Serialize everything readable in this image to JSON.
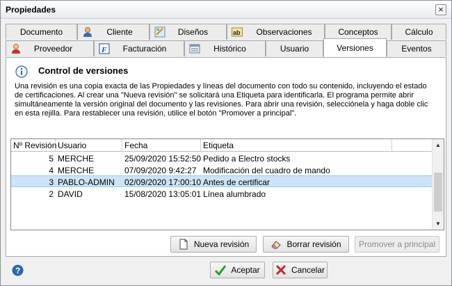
{
  "window": {
    "title": "Propiedades"
  },
  "tabs_row1": [
    {
      "label": "Documento",
      "icon": ""
    },
    {
      "label": "Cliente",
      "icon": "person-icon"
    },
    {
      "label": "Diseños",
      "icon": "design-icon"
    },
    {
      "label": "Observaciones",
      "icon": "text-ab-icon"
    },
    {
      "label": "Conceptos",
      "icon": ""
    },
    {
      "label": "Cálculo",
      "icon": ""
    }
  ],
  "tabs_row2": [
    {
      "label": "Proveedor",
      "icon": "supplier-icon"
    },
    {
      "label": "Facturación",
      "icon": "invoice-f-icon"
    },
    {
      "label": "Histórico",
      "icon": "history-icon"
    },
    {
      "label": "Usuario",
      "icon": ""
    },
    {
      "label": "Versiones",
      "icon": "",
      "active": true
    },
    {
      "label": "Eventos",
      "icon": ""
    }
  ],
  "panel": {
    "heading": "Control de versiones",
    "description": "Una revisión es una copia exacta de las Propiedades y  líneas del documento con todo su contenido, incluyendo el estado de certificaciones. Al crear una \"Nueva revisión\" se solicitará una Etiqueta para identificarla. El programa permite abrir simultáneamente la versión original del documento y las revisiones. Para abrir una revisión, selecciónela y haga doble clic en esta rejilla. Para restablecer una revisión, utilice el botón \"Promover a principal\"."
  },
  "grid": {
    "columns": [
      "Nº Revisión",
      "Usuario",
      "Fecha",
      "Etiqueta"
    ],
    "rows": [
      {
        "revision": "5",
        "user": "MERCHE",
        "date": "25/09/2020 15:52:50",
        "label": "Pedido a Electro stocks",
        "selected": false
      },
      {
        "revision": "4",
        "user": "MERCHE",
        "date": "07/09/2020 9:42:27",
        "label": "Modificación del cuadro de mando",
        "selected": false
      },
      {
        "revision": "3",
        "user": "PABLO-ADMIN",
        "date": "02/09/2020 17:00:10",
        "label": "Antes de certificar",
        "selected": true
      },
      {
        "revision": "2",
        "user": "DAVID",
        "date": "15/08/2020 13:05:01",
        "label": "Línea alumbrado",
        "selected": false
      }
    ]
  },
  "actions": {
    "new_revision": "Nueva revisión",
    "delete_revision": "Borrar revisión",
    "promote": "Promover a principal"
  },
  "footer": {
    "accept": "Aceptar",
    "cancel": "Cancelar"
  },
  "colors": {
    "selection": "#cce4f7",
    "accept_check": "#2e9a2e",
    "cancel_x": "#c0282d",
    "info_blue": "#1f5fae"
  }
}
